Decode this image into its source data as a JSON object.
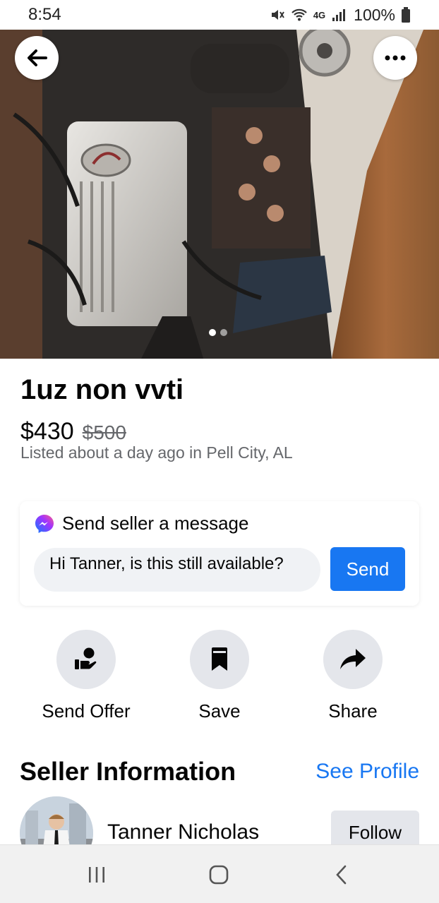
{
  "status_bar": {
    "time": "8:54",
    "network": "4G",
    "battery": "100%"
  },
  "photo": {
    "description_icon": "engine-photo",
    "total_images": 2,
    "current_image": 1
  },
  "listing": {
    "title": "1uz non vvti",
    "price": "$430",
    "original_price": "$500",
    "listed": "Listed about a day ago in Pell City, AL"
  },
  "message": {
    "heading": "Send seller a message",
    "input_value": "Hi Tanner, is this still available?",
    "send_label": "Send"
  },
  "actions": [
    {
      "label": "Send Offer",
      "icon": "offer-hand-icon"
    },
    {
      "label": "Save",
      "icon": "bookmark-icon"
    },
    {
      "label": "Share",
      "icon": "share-arrow-icon"
    }
  ],
  "seller": {
    "section_title": "Seller Information",
    "see_profile": "See Profile",
    "name": "Tanner Nicholas",
    "follow_label": "Follow"
  },
  "colors": {
    "accent": "#1877f2",
    "button_gray": "#e4e6eb",
    "secondary_text": "#65676b"
  }
}
